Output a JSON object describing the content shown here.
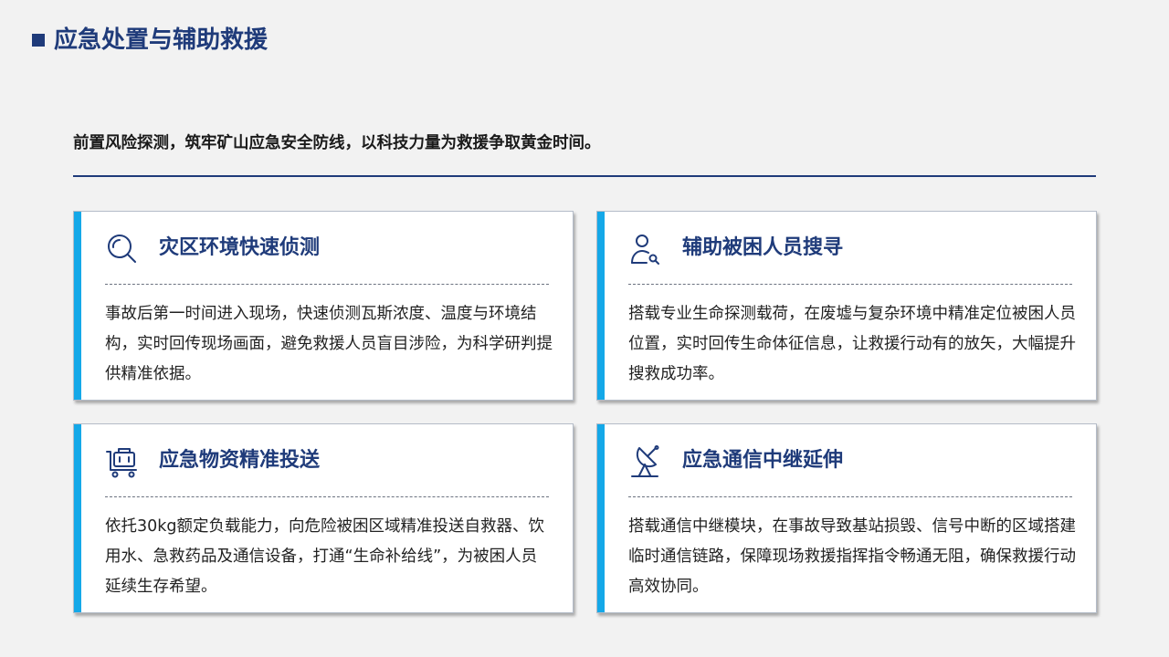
{
  "page": {
    "title": "应急处置与辅助救援",
    "subtitle": "前置风险探测，筑牢矿山应急安全防线，以科技力量为救援争取黄金时间。"
  },
  "colors": {
    "primary": "#1f3b7a",
    "accent": "#14a8e8",
    "background": "#f2f2f2"
  },
  "cards": [
    {
      "icon": "search-icon",
      "title": "灾区环境快速侦测",
      "body": "事故后第一时间进入现场，快速侦测瓦斯浓度、温度与环境结构，实时回传现场画面，避免救援人员盲目涉险，为科学研判提供精准依据。"
    },
    {
      "icon": "user-search-icon",
      "title": "辅助被困人员搜寻",
      "body": "搭载专业生命探测载荷，在废墟与复杂环境中精准定位被困人员位置，实时回传生命体征信息，让救援行动有的放矢，大幅提升搜救成功率。"
    },
    {
      "icon": "cart-icon",
      "title": "应急物资精准投送",
      "body": "依托30kg额定负载能力，向危险被困区域精准投送自救器、饮用水、急救药品及通信设备，打通“生命补给线”，为被困人员延续生存希望。"
    },
    {
      "icon": "satellite-dish-icon",
      "title": "应急通信中继延伸",
      "body": "搭载通信中继模块，在事故导致基站损毁、信号中断的区域搭建临时通信链路，保障现场救援指挥指令畅通无阻，确保救援行动高效协同。"
    }
  ]
}
